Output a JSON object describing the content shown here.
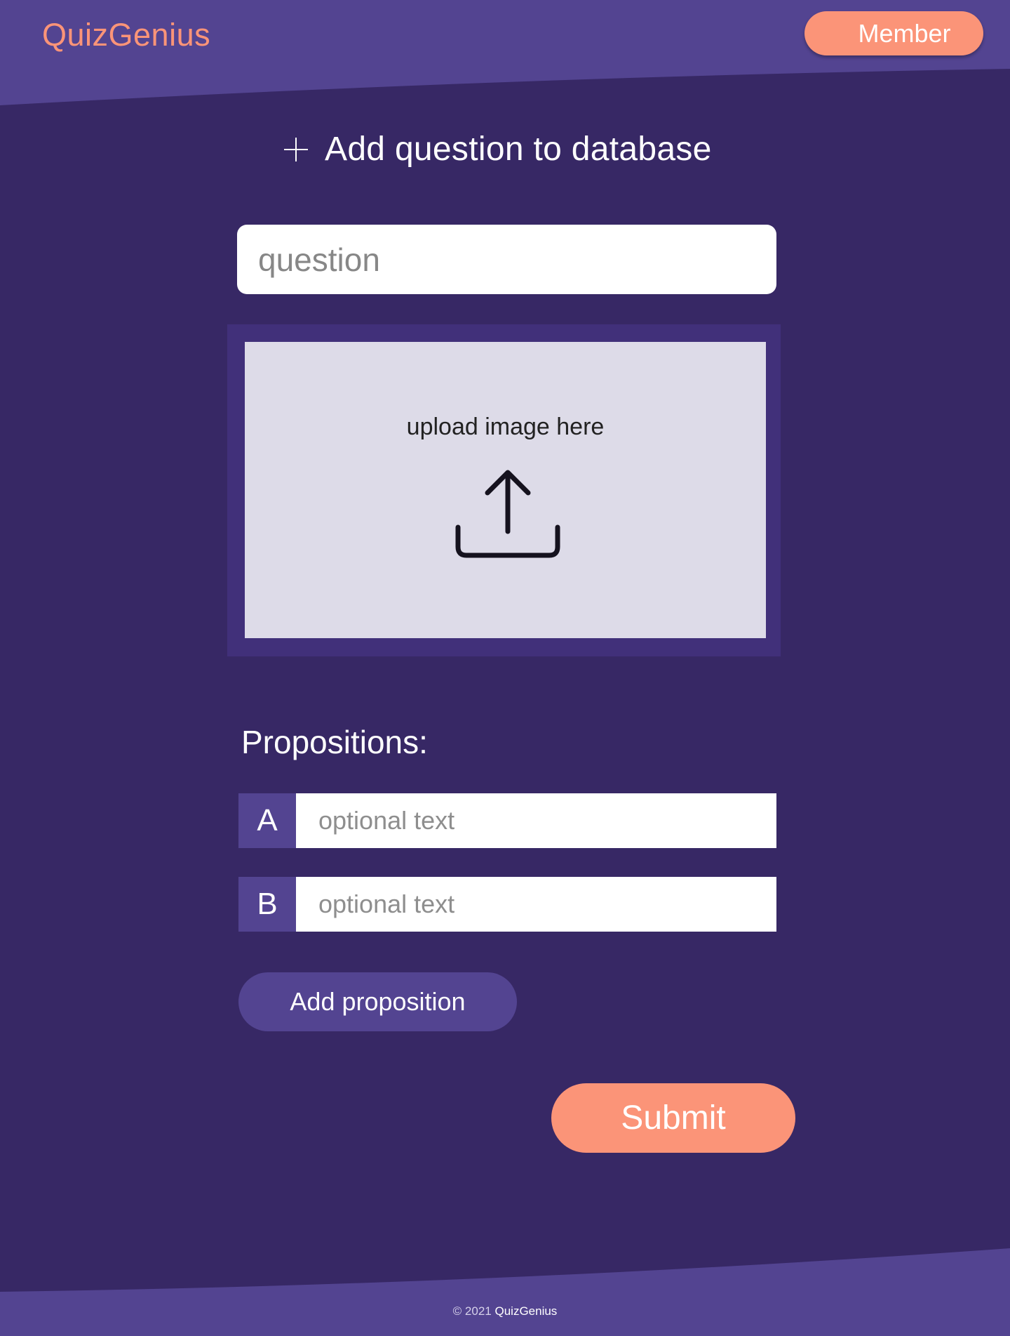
{
  "header": {
    "logo": "QuizGenius",
    "member_button": "Member"
  },
  "form": {
    "title": "Add question to database",
    "question_placeholder": "question",
    "upload_label": "upload image here",
    "propositions_title": "Propositions:",
    "propositions": [
      {
        "letter": "A",
        "placeholder": "optional text"
      },
      {
        "letter": "B",
        "placeholder": "optional text"
      }
    ],
    "add_proposition_button": "Add proposition",
    "submit_button": "Submit"
  },
  "footer": {
    "copyright": "© 2021",
    "brand": "QuizGenius"
  },
  "colors": {
    "background": "#372865",
    "header_band": "#534491",
    "accent": "#FB9478",
    "upload_zone": "#DDDBE8"
  },
  "icons": {
    "title_icon": "plus-icon",
    "upload_icon": "upload-icon"
  }
}
